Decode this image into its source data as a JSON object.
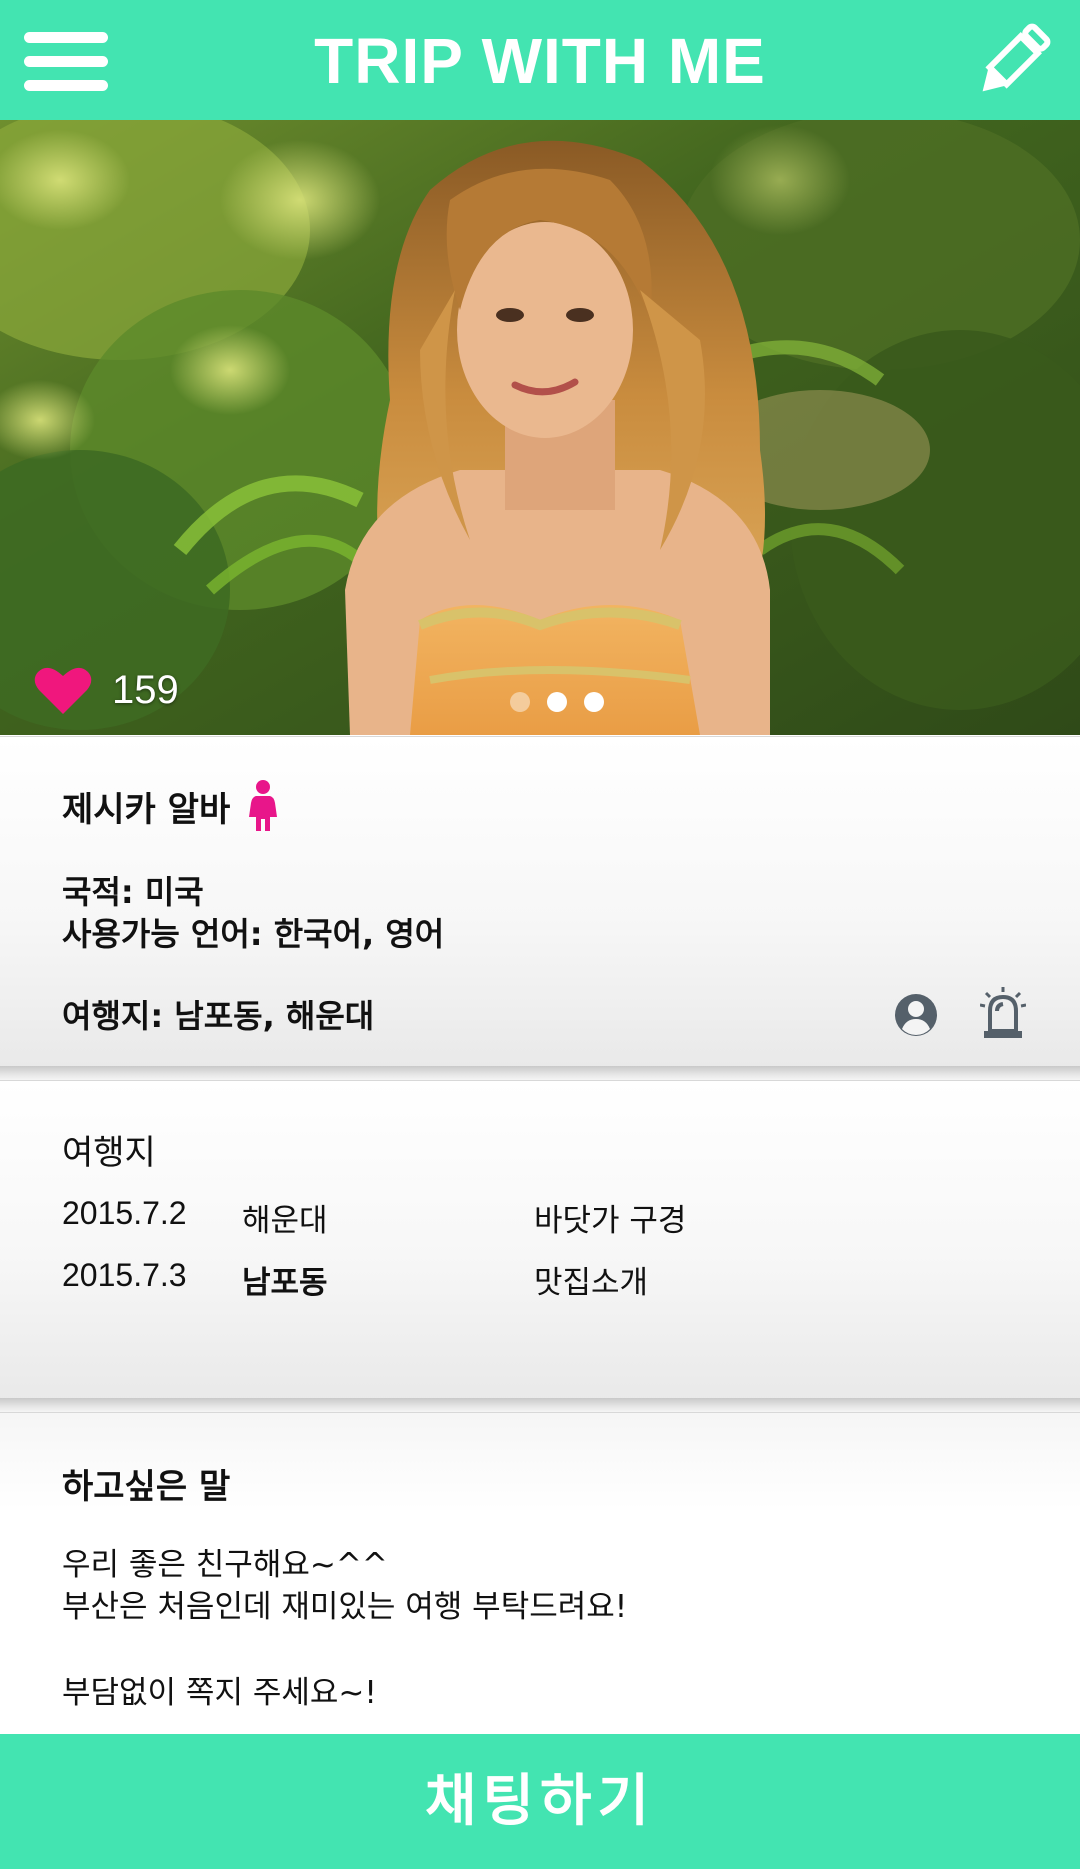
{
  "header": {
    "title": "TRIP WITH ME",
    "menu_icon": "hamburger-menu-icon",
    "edit_icon": "pencil-icon"
  },
  "photo": {
    "likes": "159",
    "like_icon": "heart-icon",
    "carousel_dots": 3,
    "active_dot": 1
  },
  "profile": {
    "name": "제시카 알바",
    "gender_icon": "female-icon",
    "nationality": "국적: 미국",
    "languages": "사용가능 언어: 한국어, 영어",
    "destinations": "여행지: 남포동, 해운대",
    "profile_icon": "user-circle-icon",
    "report_icon": "alarm-siren-icon"
  },
  "trips": {
    "title": "여행지",
    "rows": [
      {
        "date": "2015.7.2",
        "place": "해운대",
        "plan": "바닷가 구경"
      },
      {
        "date": "2015.7.3",
        "place": "남포동",
        "plan": "맛집소개"
      }
    ]
  },
  "message": {
    "title": "하고싶은 말",
    "lines": [
      "우리 좋은 친구해요~^^",
      "부산은 처음인데 재미있는 여행 부탁드려요!",
      "",
      "부담없이 쪽지 주세요~!"
    ]
  },
  "chat_button": {
    "label": "채팅하기"
  },
  "colors": {
    "accent": "#43e4b1",
    "heart": "#f0177d",
    "gender": "#e8168a",
    "icon_gray": "#55606a"
  }
}
